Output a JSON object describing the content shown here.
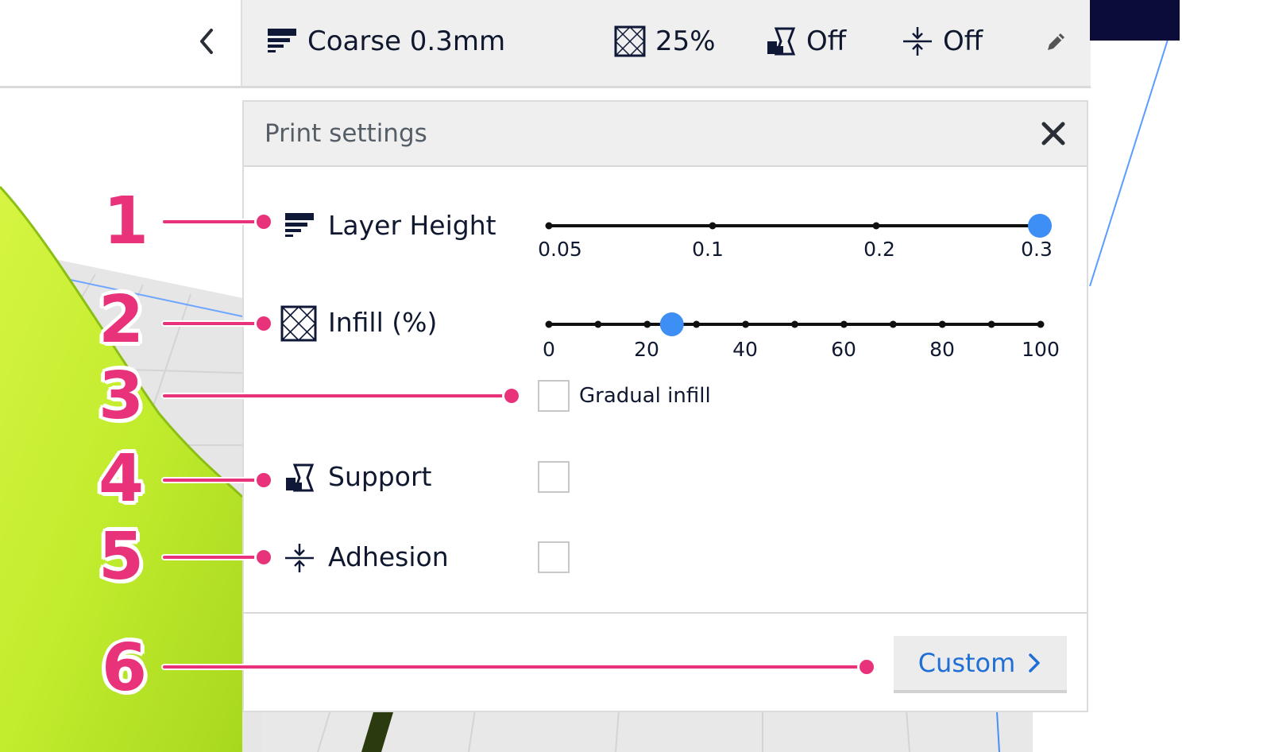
{
  "topbar": {
    "profile": "Coarse 0.3mm",
    "infill": "25%",
    "support": "Off",
    "adhesion": "Off"
  },
  "panel": {
    "title": "Print settings",
    "layer_height": {
      "label": "Layer Height",
      "ticks": [
        "0.05",
        "0.1",
        "0.2",
        "0.3"
      ],
      "value": "0.3"
    },
    "infill": {
      "label": "Infill (%)",
      "ticks": [
        "0",
        "20",
        "40",
        "60",
        "80",
        "100"
      ],
      "value": 25,
      "gradual_label": "Gradual infill",
      "gradual_checked": false
    },
    "support": {
      "label": "Support",
      "checked": false
    },
    "adhesion": {
      "label": "Adhesion",
      "checked": false
    },
    "custom_label": "Custom"
  },
  "callouts": [
    "1",
    "2",
    "3",
    "4",
    "5",
    "6"
  ],
  "colors": {
    "accent": "#1f6fd6",
    "slider_thumb": "#3d8ef5",
    "callout": "#e8337a",
    "model": "#c9f23a",
    "icon": "#101838"
  }
}
